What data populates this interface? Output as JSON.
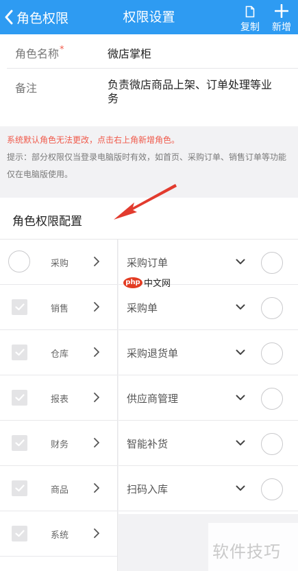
{
  "navbar": {
    "back_label": "角色权限",
    "title": "权限设置",
    "copy_label": "复制",
    "add_label": "新增"
  },
  "form": {
    "name_label": "角色名称",
    "required_mark": "*",
    "name_value": "微店掌柜",
    "note_label": "备注",
    "note_value": "负责微店商品上架、订单处理等业务"
  },
  "tips": {
    "warning": "系统默认角色无法更改，点击右上角新增角色。",
    "hint": "提示：部分权限仅当登录电脑版时有效，如首页、采购订单、销售订单等功能仅在电脑版使用。"
  },
  "section": {
    "title": "角色权限配置"
  },
  "categories": [
    {
      "label": "采购",
      "checked": false
    },
    {
      "label": "销售",
      "checked": true
    },
    {
      "label": "仓库",
      "checked": true
    },
    {
      "label": "报表",
      "checked": true
    },
    {
      "label": "财务",
      "checked": true
    },
    {
      "label": "商品",
      "checked": true
    },
    {
      "label": "系统",
      "checked": true
    }
  ],
  "permissions": [
    {
      "label": "采购订单"
    },
    {
      "label": "采购单"
    },
    {
      "label": "采购退货单"
    },
    {
      "label": "供应商管理"
    },
    {
      "label": "智能补货"
    },
    {
      "label": "扫码入库"
    }
  ],
  "watermarks": {
    "logo_text": "php",
    "logo_site": "中文网",
    "corner_text": "软件技巧"
  },
  "colors": {
    "navbar": "#2e9bf2",
    "warning_text": "#f0594a",
    "arrow": "#e23b2e"
  }
}
